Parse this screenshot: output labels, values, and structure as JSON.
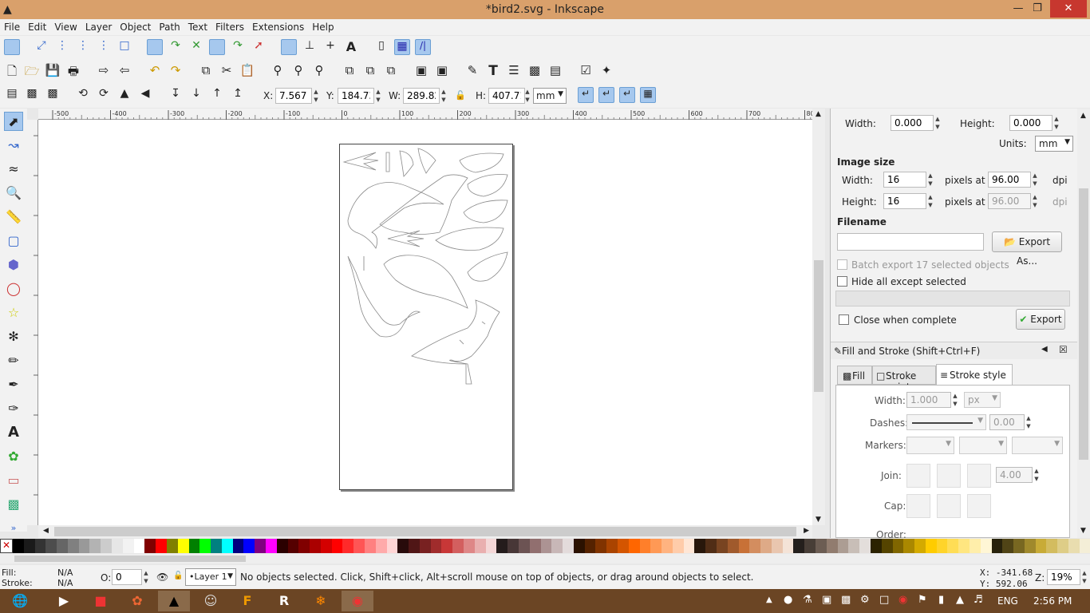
{
  "window": {
    "title": "*bird2.svg - Inkscape"
  },
  "menu": [
    "File",
    "Edit",
    "View",
    "Layer",
    "Object",
    "Path",
    "Text",
    "Filters",
    "Extensions",
    "Help"
  ],
  "toolbar3": {
    "x_label": "X:",
    "x": "7.567",
    "y_label": "Y:",
    "y": "184.736",
    "w_label": "W:",
    "w": "289.821",
    "h_label": "H:",
    "h": "407.713",
    "unit": "mm"
  },
  "export": {
    "width_label": "Width:",
    "width": "0.000",
    "height_label": "Height:",
    "height": "0.000",
    "units_label": "Units:",
    "units": "mm",
    "image_size": "Image size",
    "img_width_label": "Width:",
    "img_width": "16",
    "img_height_label": "Height:",
    "img_height": "16",
    "pixels_at": "pixels at",
    "dpi_x": "96.00",
    "dpi_y": "96.00",
    "dpi": "dpi",
    "filename": "Filename",
    "filename_value": "",
    "export_as": "Export As...",
    "batch": "Batch export 17 selected objects",
    "hide": "Hide all except selected",
    "close_when": "Close when complete",
    "export": "Export"
  },
  "fill_stroke": {
    "title": "Fill and Stroke (Shift+Ctrl+F)",
    "tabs": [
      "Fill",
      "Stroke paint",
      "Stroke style"
    ],
    "width_label": "Width:",
    "width": "1.000",
    "width_unit": "px",
    "dashes_label": "Dashes:",
    "dash_offset": "0.00",
    "markers_label": "Markers:",
    "join_label": "Join:",
    "miter": "4.00",
    "cap_label": "Cap:",
    "order_label": "Order:"
  },
  "status": {
    "fill_label": "Fill:",
    "fill": "N/A",
    "stroke_label": "Stroke:",
    "stroke": "N/A",
    "opacity_label": "O:",
    "opacity": "0",
    "layer": "•Layer 1",
    "message": "No objects selected. Click, Shift+click, Alt+scroll mouse on top of objects, or drag around objects to select.",
    "x": "X: -341.68",
    "y": "Y:  592.06",
    "zoom_label": "Z:",
    "zoom": "19%"
  },
  "ruler_labels": [
    "-500",
    "-400",
    "-300",
    "-200",
    "-100",
    "0",
    "100",
    "200",
    "300",
    "400",
    "500",
    "600",
    "700",
    "800"
  ],
  "taskbar": {
    "lang": "ENG",
    "time": "2:56 PM"
  },
  "palette": [
    "#000000",
    "#1a1a1a",
    "#333333",
    "#4d4d4d",
    "#666666",
    "#808080",
    "#999999",
    "#b3b3b3",
    "#cccccc",
    "#e6e6e6",
    "#f2f2f2",
    "#ffffff",
    "#800000",
    "#ff0000",
    "#808000",
    "#ffff00",
    "#008000",
    "#00ff00",
    "#008080",
    "#00ffff",
    "#000080",
    "#0000ff",
    "#800080",
    "#ff00ff",
    "#2b0000",
    "#550000",
    "#800000",
    "#aa0000",
    "#d40000",
    "#ff0000",
    "#ff2a2a",
    "#ff5555",
    "#ff8080",
    "#ffaaaa",
    "#ffd5d5",
    "#280b0b",
    "#501616",
    "#782121",
    "#a02c2c",
    "#c83737",
    "#d35f5f",
    "#de8787",
    "#e9afaf",
    "#f4d7d7",
    "#241c1c",
    "#483737",
    "#6c5353",
    "#916f6f",
    "#ac9393",
    "#c8b7b7",
    "#e3dbdb",
    "#2b1100",
    "#552200",
    "#803300",
    "#aa4400",
    "#d45500",
    "#ff6600",
    "#ff7f2a",
    "#ff9955",
    "#ffb380",
    "#ffccaa",
    "#ffe6d5",
    "#28170b",
    "#502d16",
    "#784421",
    "#a05a2c",
    "#c87137",
    "#d38d5f",
    "#deaa87",
    "#e9c6af",
    "#f4e3d7",
    "#241f1c",
    "#483e37",
    "#6c5d53",
    "#917c6f",
    "#ac9d93",
    "#c8beb7",
    "#e3dedb",
    "#2b2200",
    "#554400",
    "#806600",
    "#aa8800",
    "#d4aa00",
    "#ffcc00",
    "#ffd42a",
    "#ffdd55",
    "#ffe680",
    "#ffeeaa",
    "#fff6d5",
    "#28220b",
    "#504416",
    "#786721",
    "#a0892c",
    "#c8ab37",
    "#d3bc5f",
    "#decd87",
    "#e9ddaf",
    "#f4eed7"
  ]
}
